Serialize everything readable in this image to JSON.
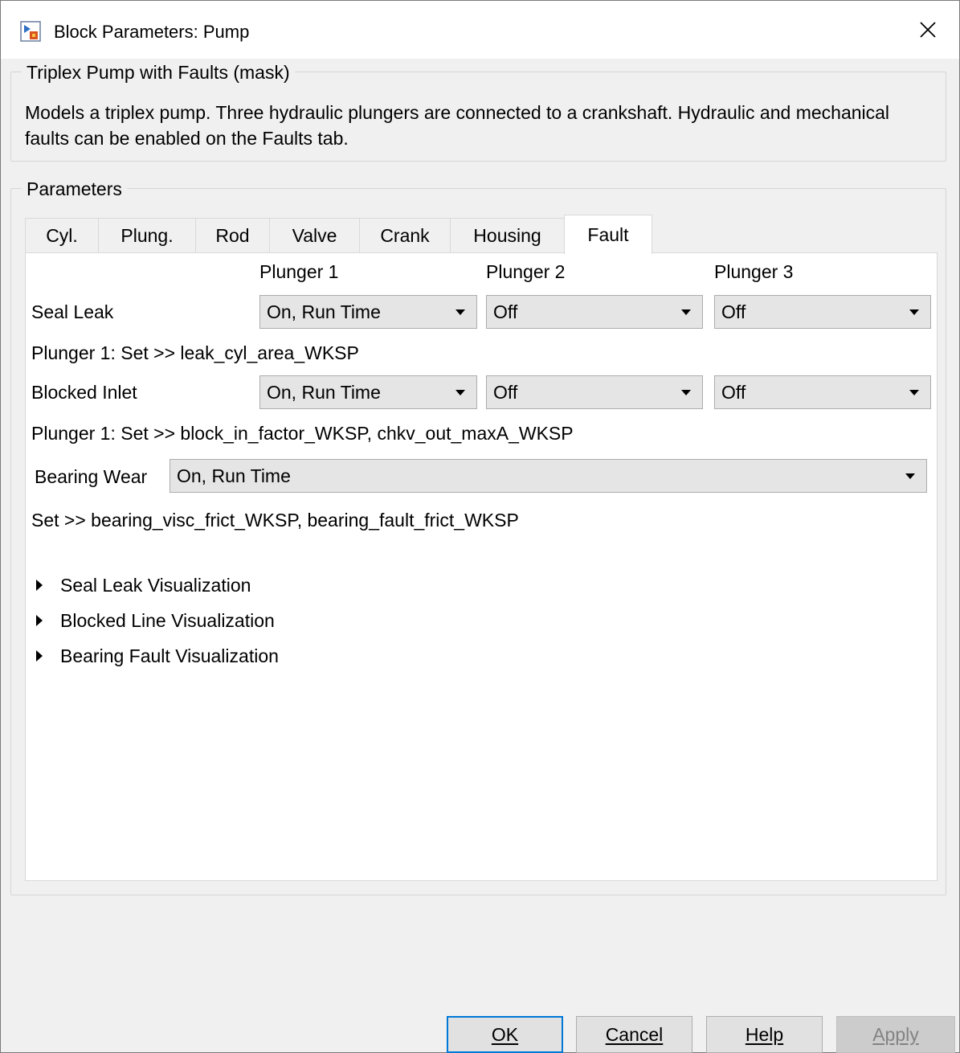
{
  "window": {
    "title": "Block Parameters: Pump",
    "icon": "simulink-block-icon",
    "close_icon": "close-icon"
  },
  "mask": {
    "group_title": "Triplex Pump with Faults (mask)",
    "description": "Models a triplex pump.  Three hydraulic plungers are connected to a crankshaft. Hydraulic and mechanical faults can be enabled on the Faults tab."
  },
  "parameters": {
    "group_title": "Parameters",
    "tabs": [
      {
        "label": "Cyl."
      },
      {
        "label": "Plung."
      },
      {
        "label": "Rod"
      },
      {
        "label": "Valve"
      },
      {
        "label": "Crank"
      },
      {
        "label": "Housing"
      },
      {
        "label": "Fault",
        "active": true
      }
    ]
  },
  "fault": {
    "col_headers": [
      "Plunger 1",
      "Plunger 2",
      "Plunger 3"
    ],
    "seal_leak": {
      "label": "Seal Leak",
      "values": [
        "On, Run Time",
        "Off",
        "Off"
      ],
      "note": "Plunger 1:  Set >> leak_cyl_area_WKSP"
    },
    "blocked_inlet": {
      "label": "Blocked Inlet",
      "values": [
        "On, Run Time",
        "Off",
        "Off"
      ],
      "note": "Plunger 1: Set >> block_in_factor_WKSP, chkv_out_maxA_WKSP"
    },
    "bearing_wear": {
      "label": "Bearing Wear",
      "value": "On, Run Time",
      "note": "Set >> bearing_visc_frict_WKSP, bearing_fault_frict_WKSP"
    },
    "sections": [
      {
        "label": "Seal Leak Visualization"
      },
      {
        "label": "Blocked Line Visualization"
      },
      {
        "label": "Bearing Fault Visualization"
      }
    ]
  },
  "buttons": {
    "ok": "OK",
    "cancel": "Cancel",
    "help": "Help",
    "apply": "Apply"
  },
  "colors": {
    "window_bg": "#f0f0f0",
    "panel_bg": "#ffffff",
    "dropdown_bg": "#e5e5e5",
    "default_button_border": "#0078d7",
    "disabled_text": "#838383"
  }
}
